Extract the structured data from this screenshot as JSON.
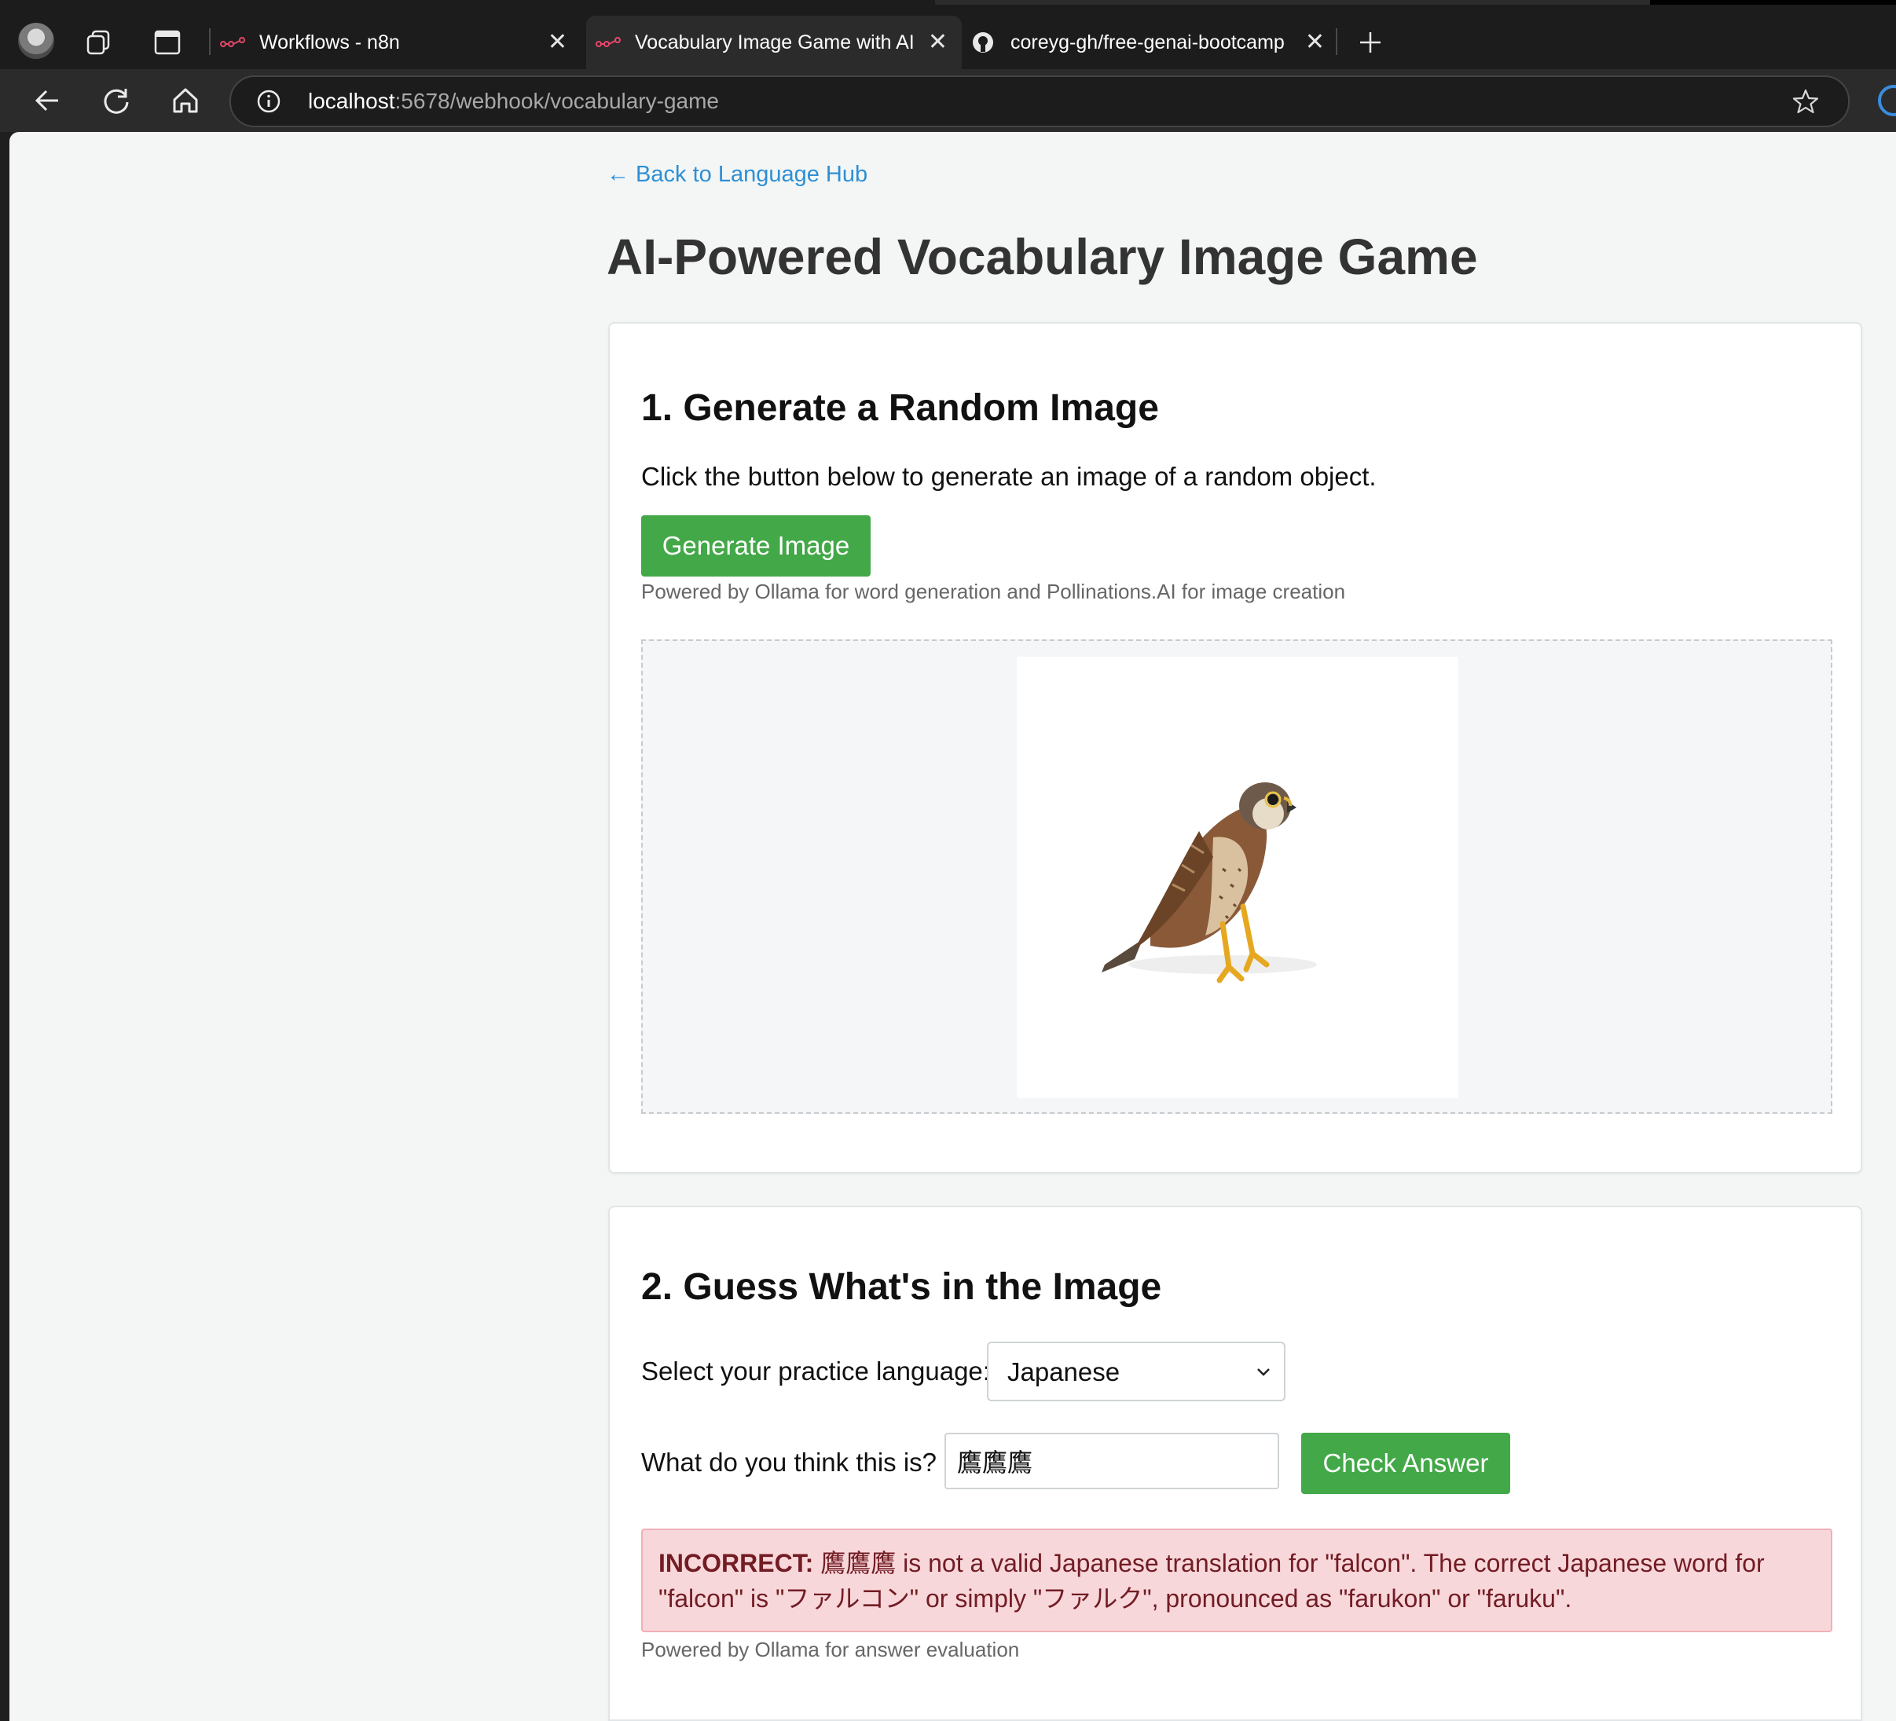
{
  "browser": {
    "tabs": [
      {
        "title": "Workflows - n8n",
        "icon": "n8n-icon"
      },
      {
        "title": "Vocabulary Image Game with AI",
        "icon": "n8n-icon",
        "active": true
      },
      {
        "title": "coreyg-gh/free-genai-bootcamp-",
        "icon": "github-icon"
      }
    ],
    "url_host": "localhost",
    "url_rest": ":5678/webhook/vocabulary-game"
  },
  "page": {
    "back_link": "← Back to Language Hub",
    "title": "AI-Powered Vocabulary Image Game"
  },
  "section1": {
    "heading": "1. Generate a Random Image",
    "description": "Click the button below to generate an image of a random object.",
    "button": "Generate Image",
    "powered_by": "Powered by Ollama for word generation and Pollinations.AI for image creation"
  },
  "section2": {
    "heading": "2. Guess What's in the Image",
    "language_label": "Select your practice language:",
    "language_selected": "Japanese",
    "guess_label": "What do you think this is?",
    "guess_value": "鷹鷹鷹",
    "button": "Check Answer",
    "result_tag": "INCORRECT:",
    "result_text": " 鷹鷹鷹 is not a valid Japanese translation for \"falcon\". The correct Japanese word for \"falcon\" is \"ファルコン\" or simply \"ファルク\", pronounced as \"farukon\" or \"faruku\".",
    "powered_by": "Powered by Ollama for answer evaluation"
  },
  "colors": {
    "accent_green": "#43a848",
    "link_blue": "#2d8fd5",
    "error_bg": "#f8d7da",
    "error_text": "#721c24"
  }
}
